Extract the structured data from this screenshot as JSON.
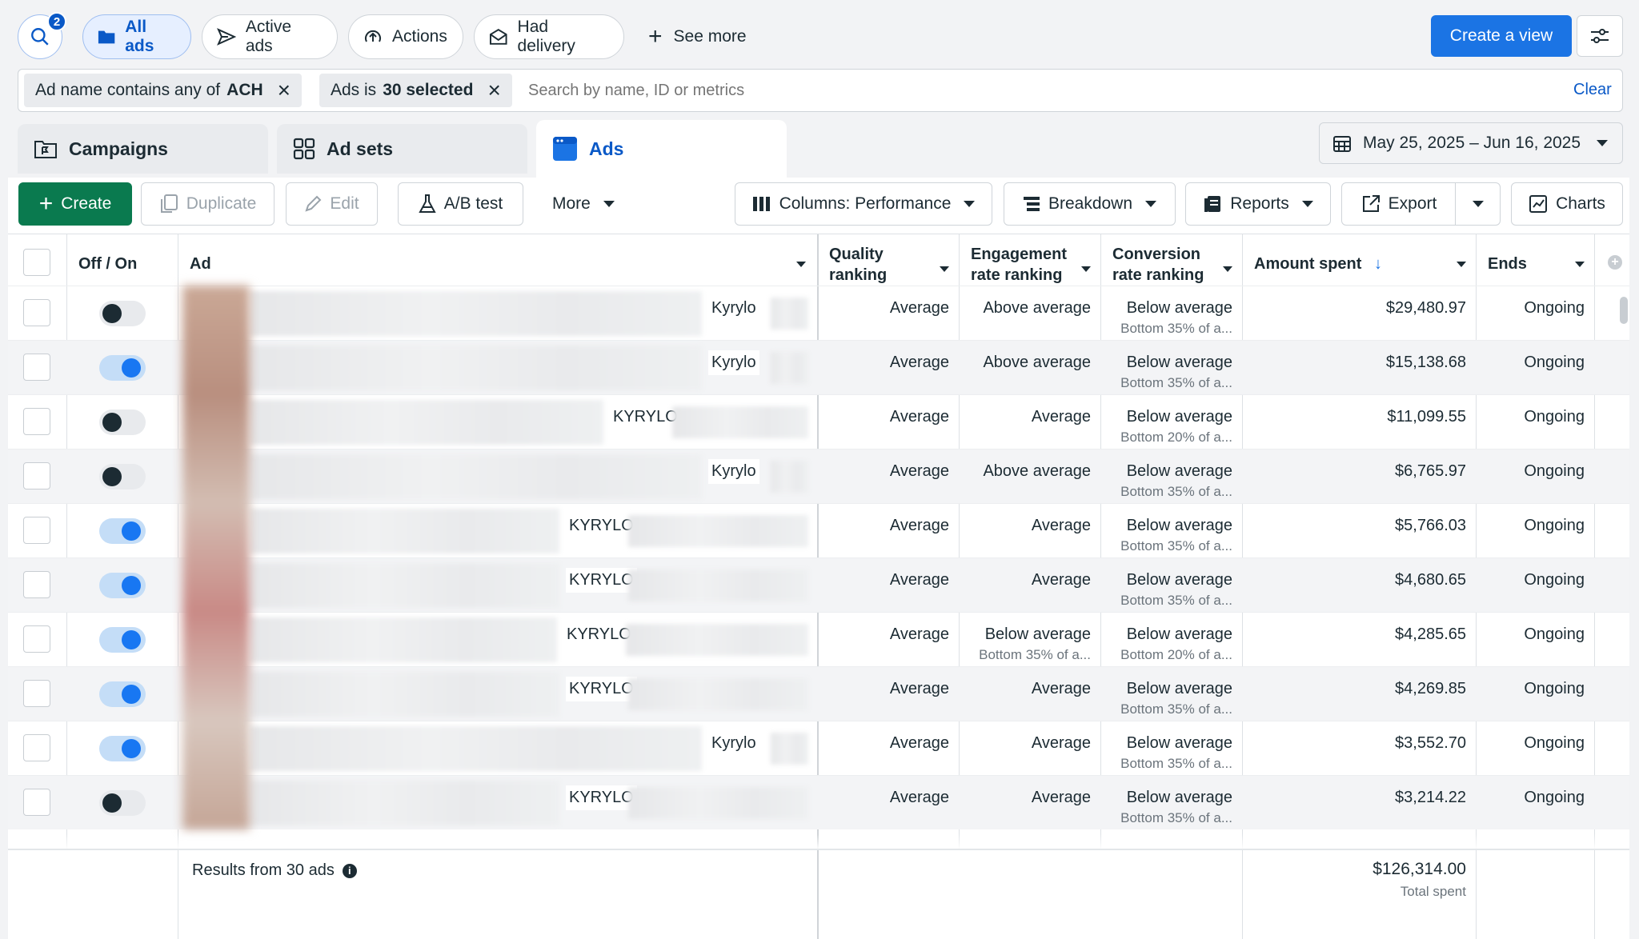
{
  "topbar": {
    "search_badge": "2",
    "filters": [
      {
        "label": "All ads",
        "selected": true,
        "icon": "folder-icon"
      },
      {
        "label": "Active ads",
        "selected": false,
        "icon": "send-icon"
      },
      {
        "label": "Actions",
        "selected": false,
        "icon": "upload-circle-icon"
      },
      {
        "label": "Had delivery",
        "selected": false,
        "icon": "envelope-icon"
      }
    ],
    "see_more": "See more",
    "create_view": "Create a view"
  },
  "filterbar": {
    "chip1_prefix": "Ad name contains any of",
    "chip1_value": "ACH",
    "chip2_prefix": "Ads is",
    "chip2_value": "30 selected",
    "search_placeholder": "Search by name, ID or metrics",
    "clear": "Clear"
  },
  "tabs": {
    "campaigns": "Campaigns",
    "adsets": "Ad sets",
    "ads": "Ads"
  },
  "date_range": "May 25, 2025 – Jun 16, 2025",
  "toolbar": {
    "create": "Create",
    "duplicate": "Duplicate",
    "edit": "Edit",
    "ab_test": "A/B test",
    "more": "More",
    "columns": "Columns: Performance",
    "breakdown": "Breakdown",
    "reports": "Reports",
    "export": "Export",
    "charts": "Charts"
  },
  "table": {
    "headers": {
      "toggle": "Off / On",
      "ad": "Ad",
      "quality_1": "Quality",
      "quality_2": "ranking",
      "engagement_1": "Engagement",
      "engagement_2": "rate ranking",
      "conversion_1": "Conversion",
      "conversion_2": "rate ranking",
      "amount": "Amount spent",
      "ends": "Ends"
    },
    "rows": [
      {
        "on": false,
        "name": "Kyrylo",
        "quality": "Average",
        "engagement": "Above average",
        "engagement_sub": "",
        "conversion": "Below average",
        "conversion_sub": "Bottom 35% of a...",
        "amount": "$29,480.97",
        "ends": "Ongoing"
      },
      {
        "on": true,
        "name": "Kyrylo",
        "quality": "Average",
        "engagement": "Above average",
        "engagement_sub": "",
        "conversion": "Below average",
        "conversion_sub": "Bottom 35% of a...",
        "amount": "$15,138.68",
        "ends": "Ongoing"
      },
      {
        "on": false,
        "name": "KYRYLO",
        "quality": "Average",
        "engagement": "Average",
        "engagement_sub": "",
        "conversion": "Below average",
        "conversion_sub": "Bottom 20% of a...",
        "amount": "$11,099.55",
        "ends": "Ongoing"
      },
      {
        "on": false,
        "name": "Kyrylo",
        "quality": "Average",
        "engagement": "Above average",
        "engagement_sub": "",
        "conversion": "Below average",
        "conversion_sub": "Bottom 35% of a...",
        "amount": "$6,765.97",
        "ends": "Ongoing"
      },
      {
        "on": true,
        "name": "KYRYLO",
        "quality": "Average",
        "engagement": "Average",
        "engagement_sub": "",
        "conversion": "Below average",
        "conversion_sub": "Bottom 35% of a...",
        "amount": "$5,766.03",
        "ends": "Ongoing"
      },
      {
        "on": true,
        "name": "KYRYLO",
        "quality": "Average",
        "engagement": "Average",
        "engagement_sub": "",
        "conversion": "Below average",
        "conversion_sub": "Bottom 35% of a...",
        "amount": "$4,680.65",
        "ends": "Ongoing"
      },
      {
        "on": true,
        "name": "KYRYLO",
        "quality": "Average",
        "engagement": "Below average",
        "engagement_sub": "Bottom 35% of a...",
        "conversion": "Below average",
        "conversion_sub": "Bottom 20% of a...",
        "amount": "$4,285.65",
        "ends": "Ongoing"
      },
      {
        "on": true,
        "name": "KYRYLO",
        "quality": "Average",
        "engagement": "Average",
        "engagement_sub": "",
        "conversion": "Below average",
        "conversion_sub": "Bottom 35% of a...",
        "amount": "$4,269.85",
        "ends": "Ongoing"
      },
      {
        "on": true,
        "name": "Kyrylo",
        "quality": "Average",
        "engagement": "Average",
        "engagement_sub": "",
        "conversion": "Below average",
        "conversion_sub": "Bottom 35% of a...",
        "amount": "$3,552.70",
        "ends": "Ongoing"
      },
      {
        "on": false,
        "name": "KYRYLO",
        "quality": "Average",
        "engagement": "Average",
        "engagement_sub": "",
        "conversion": "Below average",
        "conversion_sub": "Bottom 35% of a...",
        "amount": "$3,214.22",
        "ends": "Ongoing"
      }
    ],
    "footer": {
      "results": "Results from 30 ads",
      "total": "$126,314.00",
      "total_label": "Total spent"
    }
  },
  "colors": {
    "accent": "#0a59c7",
    "primary_button": "#1b74e4",
    "create_button": "#0a7a4f",
    "toggle_on": "#1877f2"
  }
}
